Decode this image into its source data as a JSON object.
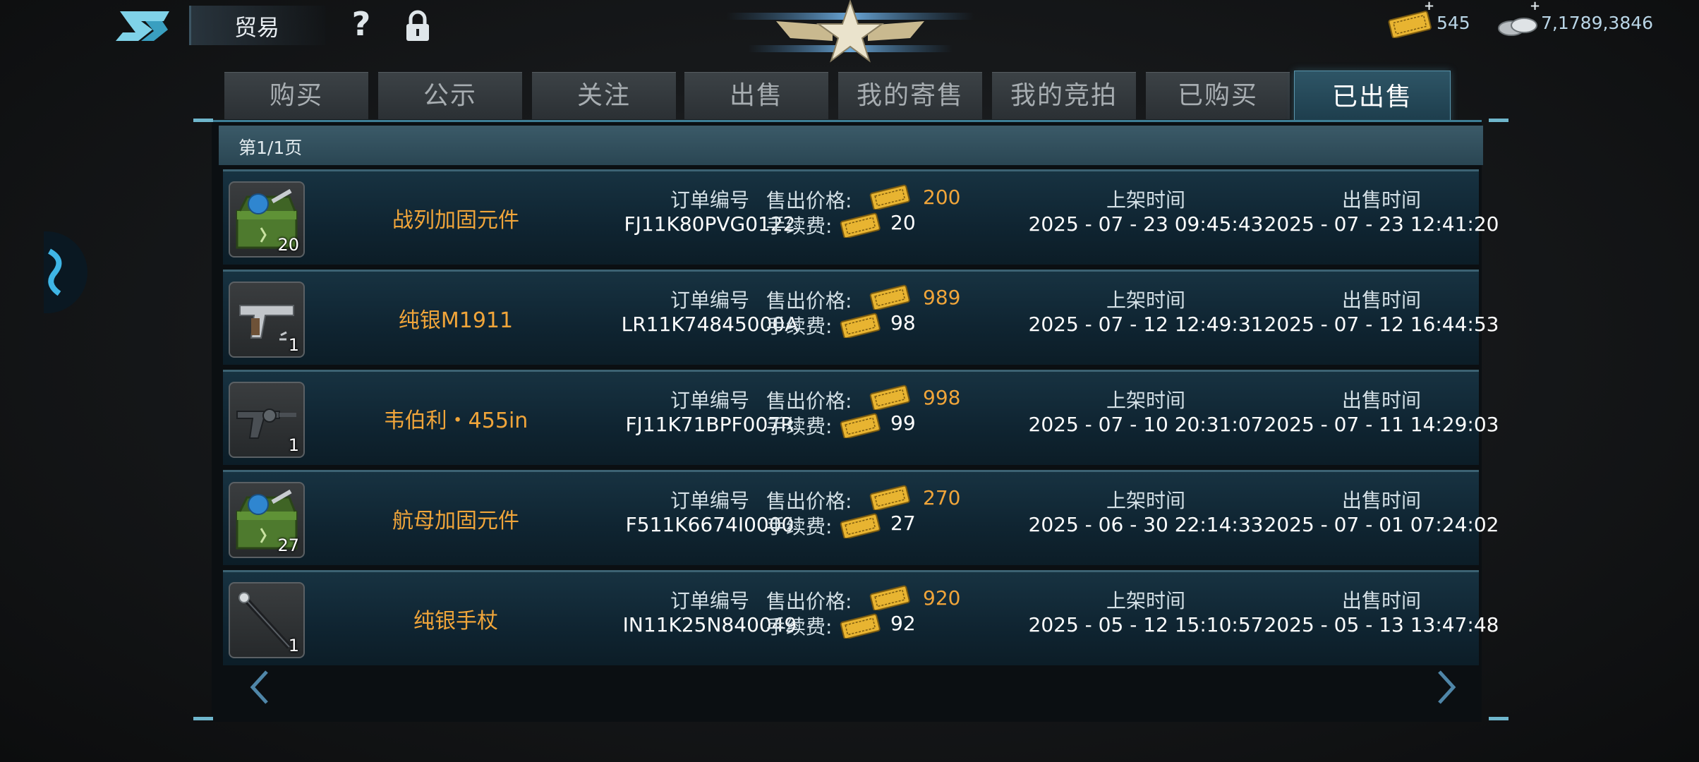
{
  "header": {
    "title": "贸易",
    "gold_value": "545",
    "silver_value": "7,1789,3846",
    "plus": "+"
  },
  "tabs": [
    {
      "label": "购买",
      "active": false
    },
    {
      "label": "公示",
      "active": false
    },
    {
      "label": "关注",
      "active": false
    },
    {
      "label": "出售",
      "active": false
    },
    {
      "label": "我的寄售",
      "active": false
    },
    {
      "label": "我的竞拍",
      "active": false
    },
    {
      "label": "已购买",
      "active": false
    },
    {
      "label": "已出售",
      "active": true
    }
  ],
  "list": {
    "page_indicator": "第1/1页",
    "labels": {
      "order_no": "订单编号",
      "sale_price": "售出价格:",
      "fee": "手续费:",
      "listed_time": "上架时间",
      "sold_time": "出售时间"
    },
    "rows": [
      {
        "name": "战列加固元件",
        "icon": "toolbox-icon",
        "qty": "20",
        "order_no": "FJ11K80PVG0122",
        "price": "200",
        "fee": "20",
        "listed": "2025 - 07 - 23 09:45:43",
        "sold": "2025 - 07 - 23 12:41:20"
      },
      {
        "name": "纯银M1911",
        "icon": "pistol-icon",
        "qty": "1",
        "order_no": "LR11K74845000A",
        "price": "989",
        "fee": "98",
        "listed": "2025 - 07 - 12 12:49:31",
        "sold": "2025 - 07 - 12 16:44:53"
      },
      {
        "name": "韦伯利・455in",
        "icon": "revolver-icon",
        "qty": "1",
        "order_no": "FJ11K71BPF007R",
        "price": "998",
        "fee": "99",
        "listed": "2025 - 07 - 10 20:31:07",
        "sold": "2025 - 07 - 11 14:29:03"
      },
      {
        "name": "航母加固元件",
        "icon": "toolbox-icon",
        "qty": "27",
        "order_no": "F511K6674I0000",
        "price": "270",
        "fee": "27",
        "listed": "2025 - 06 - 30 22:14:33",
        "sold": "2025 - 07 - 01 07:24:02"
      },
      {
        "name": "纯银手杖",
        "icon": "cane-icon",
        "qty": "1",
        "order_no": "IN11K25N840049",
        "price": "920",
        "fee": "92",
        "listed": "2025 - 05 - 12 15:10:57",
        "sold": "2025 - 05 - 13 13:47:48"
      }
    ]
  },
  "colors": {
    "item_name": "#f0a53a",
    "price_value": "#f0a53a",
    "accent": "#3d7e95"
  },
  "icons": [
    "logo-icon",
    "help-icon",
    "lock-icon",
    "rank-emblem-icon",
    "gold-ticket-icon",
    "silver-coins-icon",
    "prev-page-icon",
    "next-page-icon"
  ]
}
